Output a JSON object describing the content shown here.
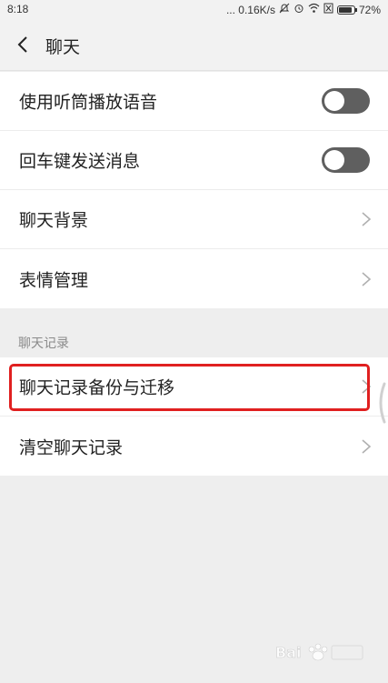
{
  "status_bar": {
    "time": "8:18",
    "network_speed": "... 0.16K/s",
    "battery_percent": "72%"
  },
  "header": {
    "title": "聊天"
  },
  "settings": {
    "voice_earpiece": "使用听筒播放语音",
    "enter_to_send": "回车键发送消息",
    "chat_background": "聊天背景",
    "sticker_management": "表情管理"
  },
  "history": {
    "section_title": "聊天记录",
    "backup_migrate": "聊天记录备份与迁移",
    "clear_history": "清空聊天记录"
  },
  "toggles": {
    "voice_earpiece_on": false,
    "enter_to_send_on": false
  },
  "colors": {
    "highlight": "#e02020",
    "toggle_off": "#5f5f5f"
  }
}
